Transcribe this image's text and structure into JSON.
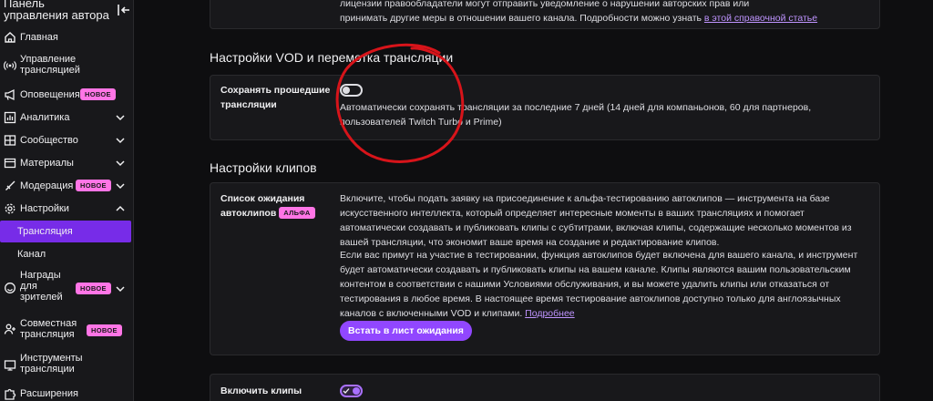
{
  "sidebar": {
    "title": "Панель управления автора",
    "items": [
      {
        "label": "Главная"
      },
      {
        "label": "Управление трансляцией"
      },
      {
        "label": "Оповещения",
        "badge": "НОВОЕ"
      },
      {
        "label": "Аналитика"
      },
      {
        "label": "Сообщество"
      },
      {
        "label": "Материалы"
      },
      {
        "label": "Модерация",
        "badge": "НОВОЕ"
      },
      {
        "label": "Настройки"
      },
      {
        "label": "Награды для зрителей",
        "badge": "НОВОЕ"
      },
      {
        "label": "Совместная трансляция",
        "badge": "НОВОЕ"
      },
      {
        "label": "Инструменты трансляции"
      },
      {
        "label": "Расширения"
      }
    ],
    "sub_items": [
      {
        "label": "Трансляция",
        "active": true
      },
      {
        "label": "Канал",
        "active": false
      }
    ]
  },
  "top_card": {
    "text_line1": "лицензии правообладатели могут отправить уведомление о нарушении авторских прав или",
    "text_line2_pre": "принимать другие меры в отношении вашего канала. Подробности можно узнать ",
    "text_line2_link": "в этой справочной статье"
  },
  "vod_section": {
    "title": "Настройки VOD и перемотка трансляции",
    "setting_label": "Сохранять прошедшие трансляции",
    "toggle_on": false,
    "description": "Автоматически сохранять трансляции за последние 7 дней (14 дней для компаньонов, 60 для партнеров, пользователей Twitch Turbo и Prime)"
  },
  "clips_section": {
    "title": "Настройки клипов",
    "waitlist_label": "Список ожидания автоклипов",
    "alpha_badge": "АЛЬФА",
    "paragraph1": "Включите, чтобы подать заявку на присоединение к альфа-тестированию автоклипов — инструмента на базе искусственного интеллекта, который определяет интересные моменты в ваших трансляциях и помогает автоматически создавать и публиковать клипы с субтитрами, включая клипы, содержащие несколько моментов из вашей трансляции, что экономит ваше время на создание и редактирование клипов.",
    "paragraph2": "Если вас примут на участие в тестировании, функция автоклипов будет включена для вашего канала, и инструмент будет автоматически создавать и публиковать клипы на вашем канале. Клипы являются вашим пользовательским контентом в соответствии с нашими Условиями обслуживания, и вы можете удалить клипы или отказаться от тестирования в любое время. В настоящее время тестирование автоклипов доступно только для англоязычных каналов с включенными VOD и клипами.",
    "more_link": "Подробнее",
    "waitlist_button": "Встать в лист ожидания",
    "enable_clips_label": "Включить клипы",
    "enable_clips_on": true
  },
  "colors": {
    "accent": "#9147ff",
    "badge": "#ff75e6",
    "annotation": "#d7141a"
  }
}
